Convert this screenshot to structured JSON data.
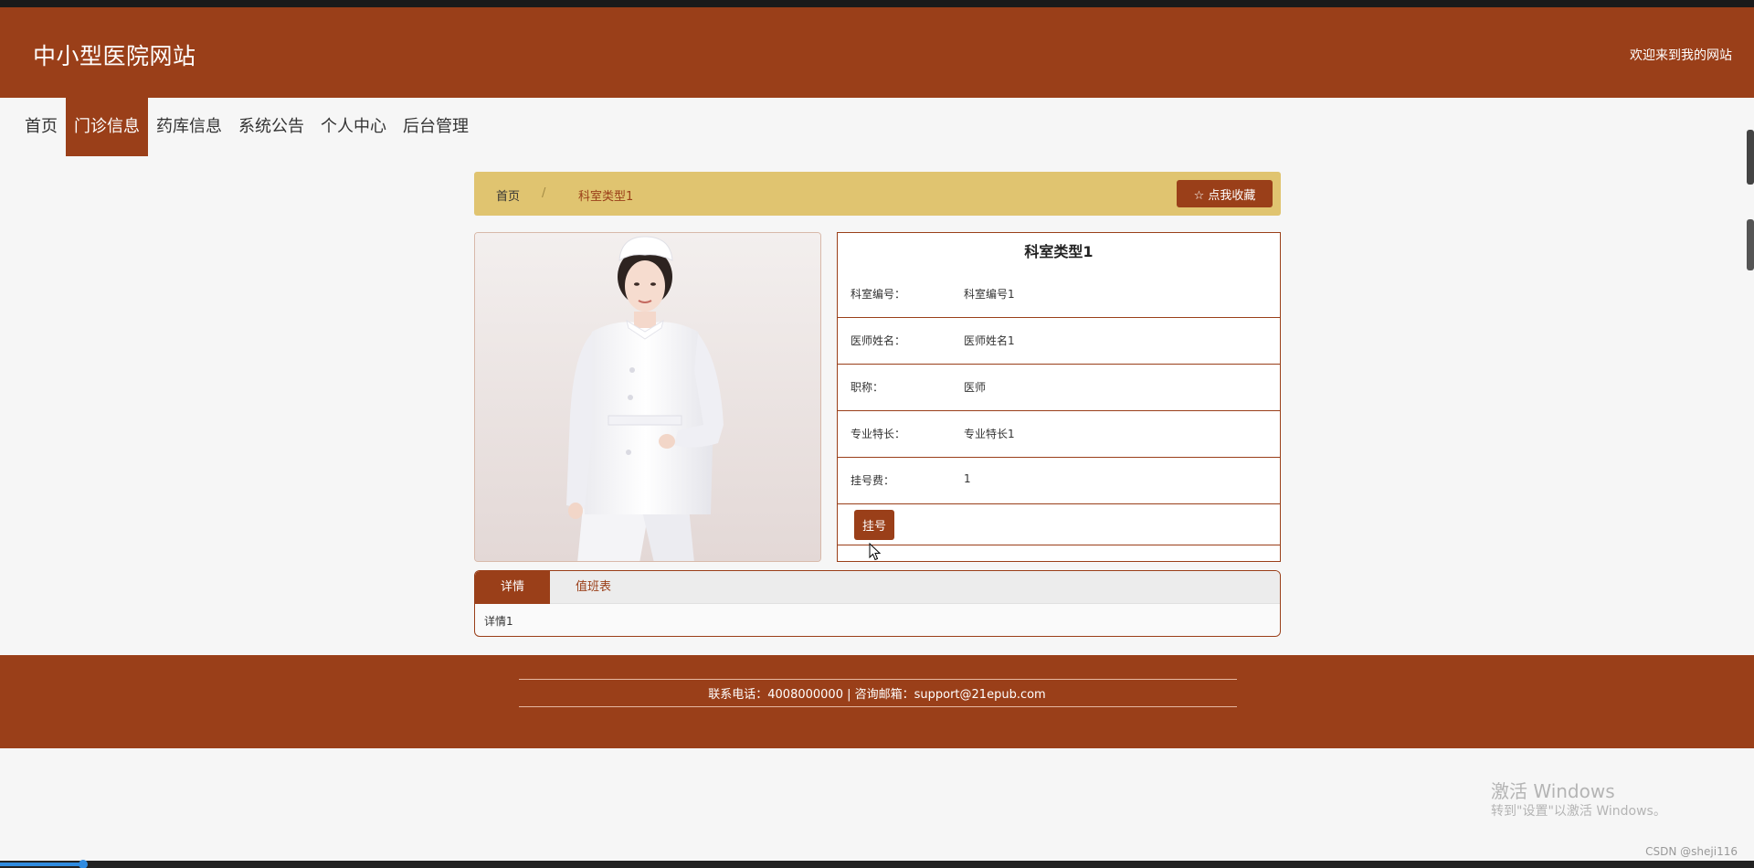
{
  "header": {
    "site_title": "中小型医院网站",
    "welcome": "欢迎来到我的网站"
  },
  "nav": {
    "items": [
      {
        "label": "首页",
        "active": false
      },
      {
        "label": "门诊信息",
        "active": true
      },
      {
        "label": "药库信息",
        "active": false
      },
      {
        "label": "系统公告",
        "active": false
      },
      {
        "label": "个人中心",
        "active": false
      },
      {
        "label": "后台管理",
        "active": false
      }
    ]
  },
  "breadcrumb": {
    "home": "首页",
    "separator": "/",
    "current": "科室类型1",
    "favorite_button": "☆ 点我收藏"
  },
  "detail": {
    "title": "科室类型1",
    "fields": [
      {
        "label": "科室编号：",
        "value": "科室编号1"
      },
      {
        "label": "医师姓名：",
        "value": "医师姓名1"
      },
      {
        "label": "职称：",
        "value": "医师"
      },
      {
        "label": "专业特长：",
        "value": "专业特长1"
      },
      {
        "label": "挂号费：",
        "value": "1"
      }
    ],
    "register_button": "挂号"
  },
  "tabs": {
    "items": [
      {
        "label": "详情",
        "active": true
      },
      {
        "label": "值班表",
        "active": false
      }
    ],
    "content": "详情1"
  },
  "footer": {
    "contact": "联系电话：4008000000 | 咨询邮箱：support@21epub.com"
  },
  "overlay": {
    "watermark_title": "激活 Windows",
    "watermark_sub": "转到\"设置\"以激活 Windows。",
    "csdn": "CSDN @sheji116"
  },
  "colors": {
    "brand": "#9a3f19",
    "breadcrumb_bg": "#e0c470",
    "page_bg": "#f6f6f6"
  }
}
